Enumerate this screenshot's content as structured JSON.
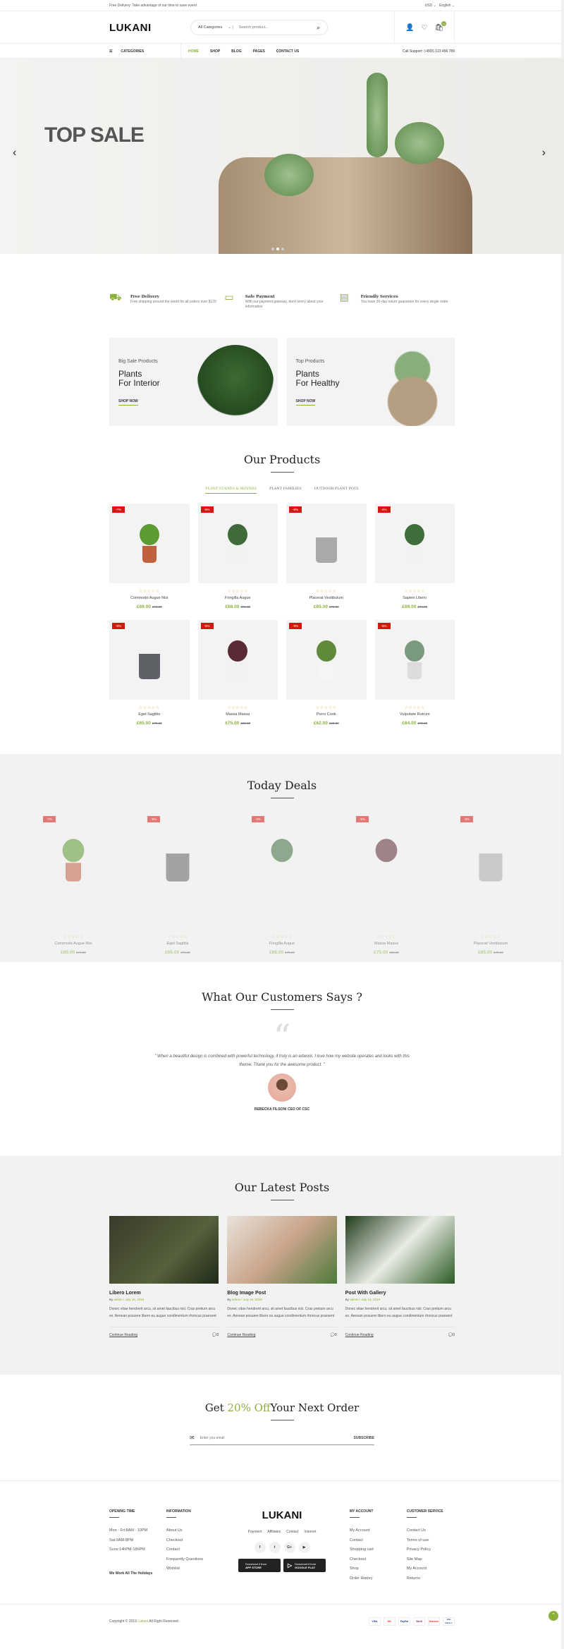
{
  "topbar": {
    "notice": "Free Delivery: Take advantage of our time to save event",
    "currency": "USD",
    "language": "English"
  },
  "header": {
    "logo": "LUKANI",
    "search_category": "All Categories",
    "search_placeholder": "Search product...",
    "cart_count": "0"
  },
  "nav": {
    "categories": "CATEGORIES",
    "items": [
      "HOME",
      "SHOP",
      "BLOG",
      "PAGES",
      "CONTACT US"
    ],
    "support": "Call Support: (+800) 123 456 789"
  },
  "hero": {
    "title": "TOP SALE"
  },
  "features": [
    {
      "title": "Free Delivery",
      "text": "Free shipping around the world for all orders over $120"
    },
    {
      "title": "Safe Payment",
      "text": "With our payment gateway, don't worry about your information"
    },
    {
      "title": "Friendly Services",
      "text": "You have 30-day return guarantee for every single order"
    }
  ],
  "banners": [
    {
      "sub": "Big Sale Products",
      "line1": "Plants",
      "line2": "For Interior",
      "cta": "SHOP NOW"
    },
    {
      "sub": "Top Products",
      "line1": "Plants",
      "line2": "For Healthy",
      "cta": "SHOP NOW"
    }
  ],
  "products": {
    "title": "Our Products",
    "tabs": [
      "PLANT STANDS & MOVERS",
      "PLANT FAMILIES",
      "OUTDOOR PLANT POTS"
    ],
    "items": [
      {
        "name": "Commodo Augue Nisi",
        "price": "£69.00",
        "old": "£74.00",
        "discount": "-7%"
      },
      {
        "name": "Fringilla Augue",
        "price": "£68.00",
        "old": "£76.00",
        "discount": "-6%"
      },
      {
        "name": "Placerat Vestibulum",
        "price": "£65.00",
        "old": "£70.00",
        "discount": "-8%"
      },
      {
        "name": "Sapien Libero",
        "price": "£69.00",
        "old": "£74.00",
        "discount": "-4%"
      },
      {
        "name": "Eget Sagittis",
        "price": "£65.00",
        "old": "£70.00",
        "discount": "-9%"
      },
      {
        "name": "Massa Massa",
        "price": "£75.00",
        "old": "£80.00",
        "discount": "-5%"
      },
      {
        "name": "Porro Cook",
        "price": "£62.00",
        "old": "£68.00",
        "discount": "-9%"
      },
      {
        "name": "Vulputate Rutrum",
        "price": "£64.00",
        "old": "£72.00",
        "discount": "-6%"
      }
    ]
  },
  "deals": {
    "title": "Today Deals",
    "items": [
      {
        "name": "Commodo Augue Nisi",
        "price": "£69.00",
        "old": "£74.00",
        "discount": "-7%"
      },
      {
        "name": "Eget Sagittis",
        "price": "£65.00",
        "old": "£70.00",
        "discount": "-9%"
      },
      {
        "name": "Fringilla Augue",
        "price": "£68.00",
        "old": "£76.00",
        "discount": "-6%"
      },
      {
        "name": "Massa Massa",
        "price": "£75.00",
        "old": "£80.00",
        "discount": "-5%"
      },
      {
        "name": "Placerat Vestibulum",
        "price": "£65.00",
        "old": "£70.00",
        "discount": "-8%"
      }
    ]
  },
  "testimonial": {
    "title": "What Our Customers Says ?",
    "quote": "\" When a beautiful design is combined with powerful technology, it truly is an artwork. I love how my website operates and looks with this theme. Thank you for the awesome product. \"",
    "author": "REBECKA FILSON/ CEO OF CSC"
  },
  "posts": {
    "title": "Our Latest Posts",
    "items": [
      {
        "title": "Libero Lorem",
        "by": "By",
        "author": "admin / July 16, 2019",
        "excerpt": "Donec vitae hendrerit arcu, sit amet faucibus nisl. Cras pretium arcu ex. Aenean posuere libero eu augue condimentum rhoncus praesent",
        "more": "Continue Reading",
        "comments": "0"
      },
      {
        "title": "Blog Image Post",
        "by": "By",
        "author": "admin / July 16, 2019",
        "excerpt": "Donec vitae hendrerit arcu, sit amet faucibus nisl. Cras pretium arcu ex. Aenean posuere libero eu augue condimentum rhoncus praesent",
        "more": "Continue Reading",
        "comments": "0"
      },
      {
        "title": "Post With Gallery",
        "by": "By",
        "author": "admin / July 16, 2019",
        "excerpt": "Donec vitae hendrerit arcu, sit amet faucibus nisl. Cras pretium arcu ex. Aenean posuere libero eu augue condimentum rhoncus praesent",
        "more": "Continue Reading",
        "comments": "0"
      }
    ]
  },
  "subscribe": {
    "title_pre": "Get ",
    "title_accent": "20% Off",
    "title_post": "Your Next Order",
    "placeholder": "Enter you email",
    "button": "SUBSCRIBE"
  },
  "footer": {
    "opening": {
      "title": "OPENING TIME",
      "lines": [
        "Mon - Fri:8AM - 10PM",
        "Sat:9AM-8PM",
        "Suns:14hPM-18hPM"
      ],
      "note": "We Work All The Holidays"
    },
    "information": {
      "title": "INFORMATION",
      "links": [
        "About Us",
        "Checkout",
        "Contact",
        "Frequently Questions",
        "Wishlist"
      ]
    },
    "logo": "LUKANI",
    "links": [
      "Payment",
      "Affiliates",
      "Contact",
      "Internet"
    ],
    "social": [
      "f",
      "t",
      "G+",
      "yt"
    ],
    "stores": [
      {
        "small": "Download it from",
        "big": "APP STORE"
      },
      {
        "small": "Download it from",
        "big": "GOOGLE PLAY"
      }
    ],
    "account": {
      "title": "MY ACCOUNT",
      "links": [
        "My Account",
        "Contact",
        "Shopping cart",
        "Checkout",
        "Shop",
        "Order History"
      ]
    },
    "service": {
      "title": "CUSTOMER SERVICE",
      "links": [
        "Contact Us",
        "Terms of use",
        "Privacy Policy",
        "Site Map",
        "My Account",
        "Returns"
      ]
    }
  },
  "copyright": {
    "pre": "Copyright © 2019 ",
    "brand": "Lukani",
    "post": " All Right Reserved.",
    "payments": [
      "VISA",
      "MC",
      "PayPal",
      "Skrill",
      "Maestro",
      "VISA Electron"
    ]
  },
  "colors": {
    "accent": "#8cb13a",
    "discount": "#d9150f"
  }
}
